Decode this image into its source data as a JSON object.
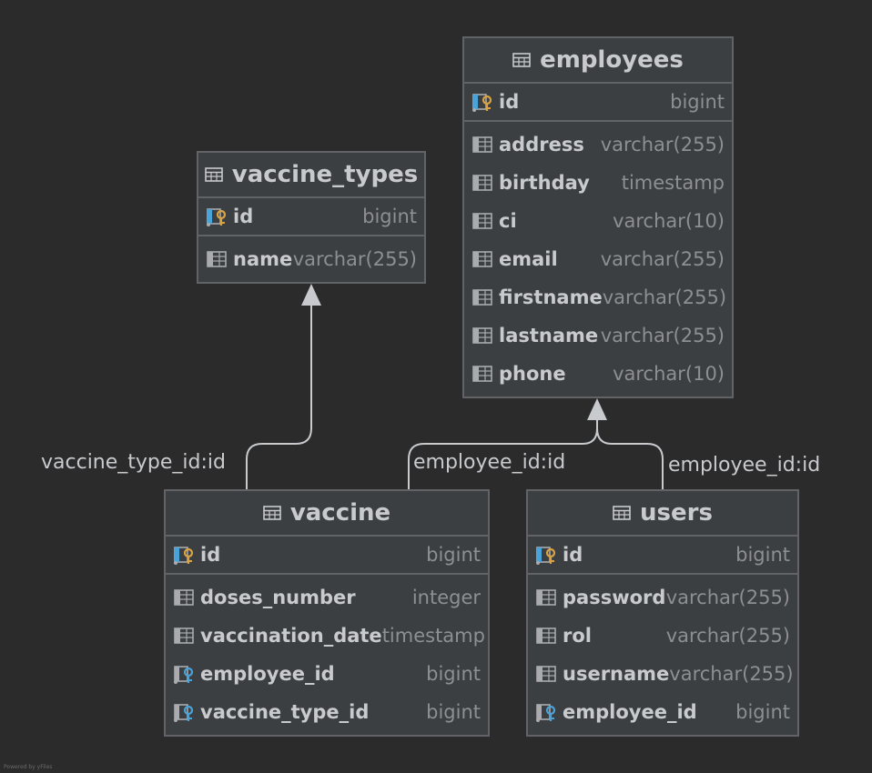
{
  "tables": {
    "employees": {
      "name": "employees",
      "columns": [
        {
          "name": "id",
          "type": "bigint",
          "kind": "pk"
        },
        {
          "name": "address",
          "type": "varchar(255)",
          "kind": "col"
        },
        {
          "name": "birthday",
          "type": "timestamp",
          "kind": "col"
        },
        {
          "name": "ci",
          "type": "varchar(10)",
          "kind": "col"
        },
        {
          "name": "email",
          "type": "varchar(255)",
          "kind": "col"
        },
        {
          "name": "firstname",
          "type": "varchar(255)",
          "kind": "col"
        },
        {
          "name": "lastname",
          "type": "varchar(255)",
          "kind": "col"
        },
        {
          "name": "phone",
          "type": "varchar(10)",
          "kind": "col"
        }
      ]
    },
    "vaccine_types": {
      "name": "vaccine_types",
      "columns": [
        {
          "name": "id",
          "type": "bigint",
          "kind": "pk"
        },
        {
          "name": "name",
          "type": "varchar(255)",
          "kind": "col"
        }
      ]
    },
    "vaccine": {
      "name": "vaccine",
      "columns": [
        {
          "name": "id",
          "type": "bigint",
          "kind": "pk"
        },
        {
          "name": "doses_number",
          "type": "integer",
          "kind": "col"
        },
        {
          "name": "vaccination_date",
          "type": "timestamp",
          "kind": "col"
        },
        {
          "name": "employee_id",
          "type": "bigint",
          "kind": "fk"
        },
        {
          "name": "vaccine_type_id",
          "type": "bigint",
          "kind": "fk"
        }
      ]
    },
    "users": {
      "name": "users",
      "columns": [
        {
          "name": "id",
          "type": "bigint",
          "kind": "pk"
        },
        {
          "name": "password",
          "type": "varchar(255)",
          "kind": "col"
        },
        {
          "name": "rol",
          "type": "varchar(255)",
          "kind": "col"
        },
        {
          "name": "username",
          "type": "varchar(255)",
          "kind": "col"
        },
        {
          "name": "employee_id",
          "type": "bigint",
          "kind": "fk"
        }
      ]
    }
  },
  "relations": {
    "vaccine_type": "vaccine_type_id:id",
    "vaccine_employee": "employee_id:id",
    "users_employee": "employee_id:id"
  },
  "footer": "Powered by yFiles",
  "colors": {
    "background": "#2b2b2b",
    "table_bg": "#3c3f41",
    "border": "#616366",
    "pk_key": "#d9a343",
    "fk_key": "#4aa3d8",
    "edge": "#c8cace"
  },
  "icons": {
    "table": "table-grid-icon",
    "pk": "primary-key-icon",
    "fk": "foreign-key-icon",
    "col": "column-icon"
  }
}
